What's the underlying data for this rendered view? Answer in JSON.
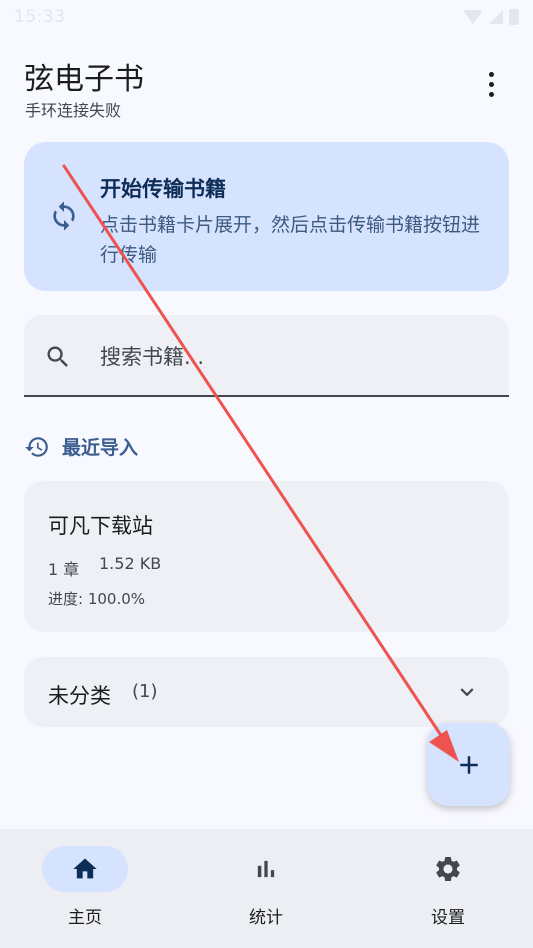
{
  "status_bar": {
    "time": "15:33"
  },
  "header": {
    "title": "弦电子书",
    "subtitle": "手环连接失败"
  },
  "transfer_card": {
    "title": "开始传输书籍",
    "description": "点击书籍卡片展开，然后点击传输书籍按钮进行传输"
  },
  "search": {
    "placeholder": "搜索书籍..."
  },
  "recent": {
    "label": "最近导入",
    "book": {
      "title": "可凡下载站",
      "chapters": "1 章",
      "size": "1.52 KB",
      "progress": "进度: 100.0%"
    }
  },
  "category": {
    "label": "未分类",
    "count": "(1)"
  },
  "fab": {
    "icon": "plus-icon"
  },
  "bottom_nav": {
    "items": [
      {
        "label": "主页",
        "icon": "home-icon",
        "active": true
      },
      {
        "label": "统计",
        "icon": "bar-chart-icon",
        "active": false
      },
      {
        "label": "设置",
        "icon": "gear-icon",
        "active": false
      }
    ]
  },
  "colors": {
    "accent": "#3b5d8f",
    "card_primary": "#d6e3ff",
    "surface": "#eef0f6",
    "annotation_arrow": "#ef5350"
  }
}
